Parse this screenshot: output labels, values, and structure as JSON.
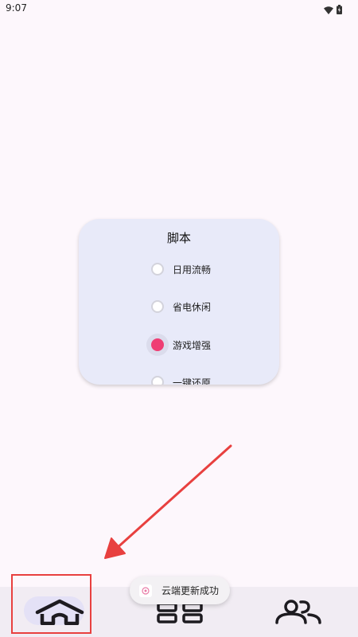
{
  "status_bar": {
    "time": "9:07",
    "icons": [
      "wifi-icon",
      "battery-icon"
    ]
  },
  "card": {
    "title": "脚本",
    "options": [
      {
        "label": "日用流畅",
        "selected": false
      },
      {
        "label": "省电休闲",
        "selected": false
      },
      {
        "label": "游戏增强",
        "selected": true
      },
      {
        "label": "一键还原",
        "selected": false
      }
    ]
  },
  "toast": {
    "text": "云端更新成功"
  },
  "bottom_nav": {
    "items": [
      {
        "icon": "home-icon",
        "selected": true
      },
      {
        "icon": "apps-grid-icon",
        "selected": false
      },
      {
        "icon": "users-icon",
        "selected": false
      }
    ]
  },
  "colors": {
    "background": "#fdf7fc",
    "card": "#e8eaf9",
    "radio_selected": "#ef3e74",
    "annotation": "#e8403f",
    "nav_bar": "#f1ecf3",
    "nav_pill": "#e4e1f6"
  }
}
